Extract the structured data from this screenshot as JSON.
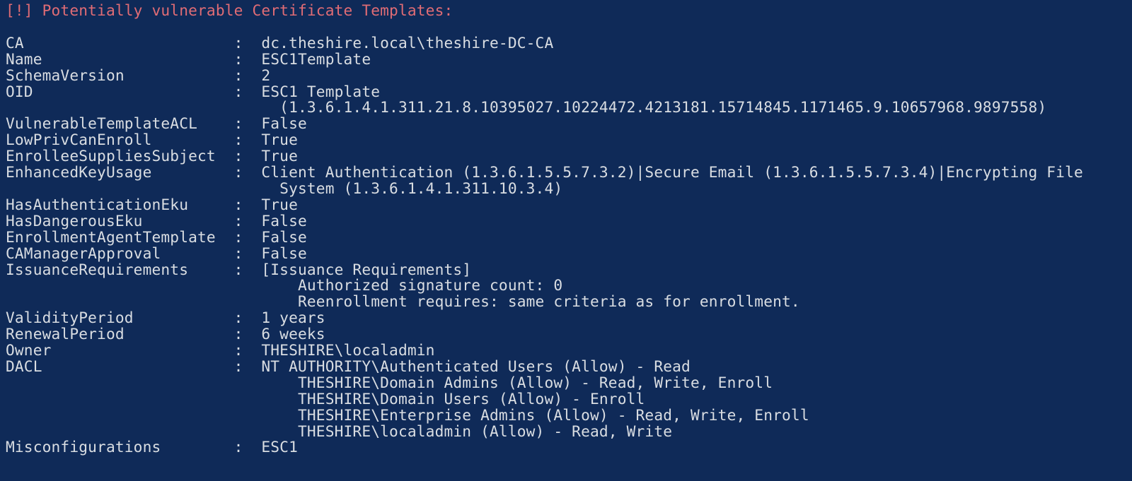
{
  "header": "[!] Potentially vulnerable Certificate Templates:",
  "key_col_width": 24,
  "val_indent": 30,
  "fields": [
    {
      "key": "CA",
      "value": [
        "dc.theshire.local\\theshire-DC-CA"
      ]
    },
    {
      "key": "Name",
      "value": [
        "ESC1Template"
      ]
    },
    {
      "key": "SchemaVersion",
      "value": [
        "2"
      ]
    },
    {
      "key": "OID",
      "value": [
        "ESC1 Template",
        "(1.3.6.1.4.1.311.21.8.10395027.10224472.4213181.15714845.1171465.9.10657968.9897558)"
      ]
    },
    {
      "key": "VulnerableTemplateACL",
      "value": [
        "False"
      ]
    },
    {
      "key": "LowPrivCanEnroll",
      "value": [
        "True"
      ]
    },
    {
      "key": "EnrolleeSuppliesSubject",
      "value": [
        "True"
      ]
    },
    {
      "key": "EnhancedKeyUsage",
      "value": [
        "Client Authentication (1.3.6.1.5.5.7.3.2)|Secure Email (1.3.6.1.5.5.7.3.4)|Encrypting File",
        "System (1.3.6.1.4.1.311.10.3.4)"
      ]
    },
    {
      "key": "HasAuthenticationEku",
      "value": [
        "True"
      ]
    },
    {
      "key": "HasDangerousEku",
      "value": [
        "False"
      ]
    },
    {
      "key": "EnrollmentAgentTemplate",
      "value": [
        "False"
      ]
    },
    {
      "key": "CAManagerApproval",
      "value": [
        "False"
      ]
    },
    {
      "key": "IssuanceRequirements",
      "value": [
        "[Issuance Requirements]",
        "  Authorized signature count: 0",
        "  Reenrollment requires: same criteria as for enrollment."
      ]
    },
    {
      "key": "ValidityPeriod",
      "value": [
        "1 years"
      ]
    },
    {
      "key": "RenewalPeriod",
      "value": [
        "6 weeks"
      ]
    },
    {
      "key": "Owner",
      "value": [
        "THESHIRE\\localadmin"
      ]
    },
    {
      "key": "DACL",
      "value": [
        "NT AUTHORITY\\Authenticated Users (Allow) - Read",
        "  THESHIRE\\Domain Admins (Allow) - Read, Write, Enroll",
        "  THESHIRE\\Domain Users (Allow) - Enroll",
        "  THESHIRE\\Enterprise Admins (Allow) - Read, Write, Enroll",
        "  THESHIRE\\localadmin (Allow) - Read, Write"
      ]
    },
    {
      "key": "Misconfigurations",
      "value": [
        "ESC1"
      ]
    }
  ]
}
